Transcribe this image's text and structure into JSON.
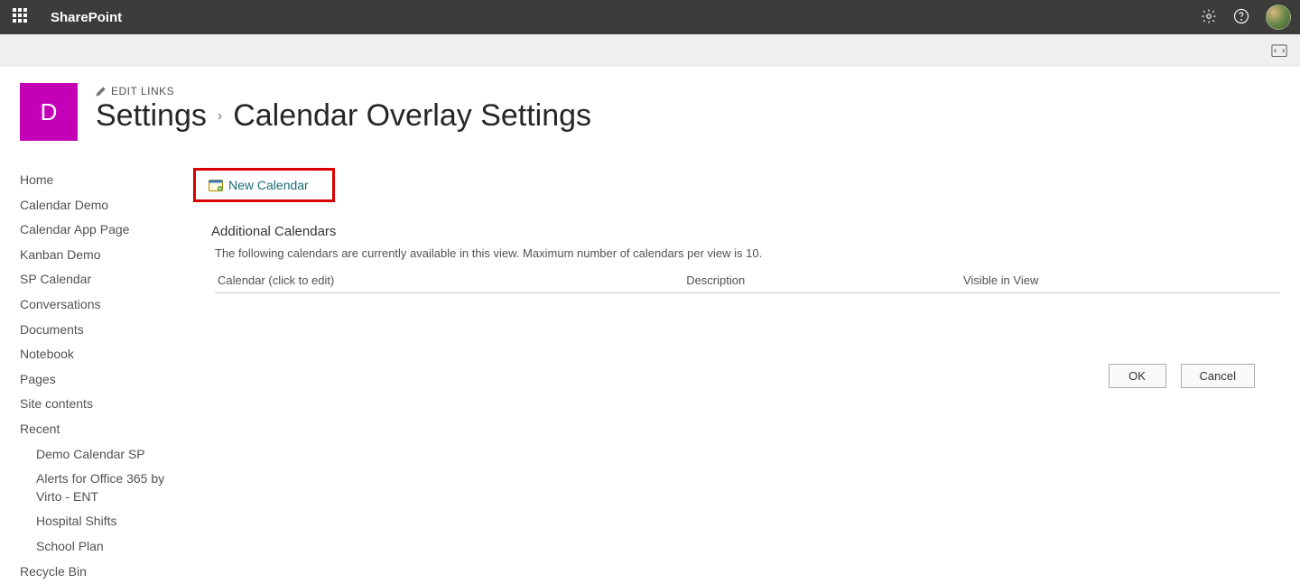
{
  "suite": {
    "brand": "SharePoint"
  },
  "siteLogo": {
    "letter": "D"
  },
  "editLinks": "EDIT LINKS",
  "breadcrumb": {
    "root": "Settings",
    "current": "Calendar Overlay Settings"
  },
  "nav": {
    "items": [
      {
        "label": "Home"
      },
      {
        "label": "Calendar Demo"
      },
      {
        "label": "Calendar App Page"
      },
      {
        "label": "Kanban Demo"
      },
      {
        "label": "SP Calendar"
      },
      {
        "label": "Conversations"
      },
      {
        "label": "Documents"
      },
      {
        "label": "Notebook"
      },
      {
        "label": "Pages"
      },
      {
        "label": "Site contents"
      },
      {
        "label": "Recent"
      }
    ],
    "recent": [
      {
        "label": "Demo Calendar SP"
      },
      {
        "label": "Alerts for Office 365 by Virto - ENT"
      },
      {
        "label": "Hospital Shifts"
      },
      {
        "label": "School Plan"
      }
    ],
    "recycle": "Recycle Bin"
  },
  "newCalendar": "New Calendar",
  "section": {
    "title": "Additional Calendars",
    "desc": "The following calendars are currently available in this view. Maximum number of calendars per view is 10."
  },
  "columns": {
    "cal": "Calendar (click to edit)",
    "desc": "Description",
    "vis": "Visible in View"
  },
  "buttons": {
    "ok": "OK",
    "cancel": "Cancel"
  }
}
